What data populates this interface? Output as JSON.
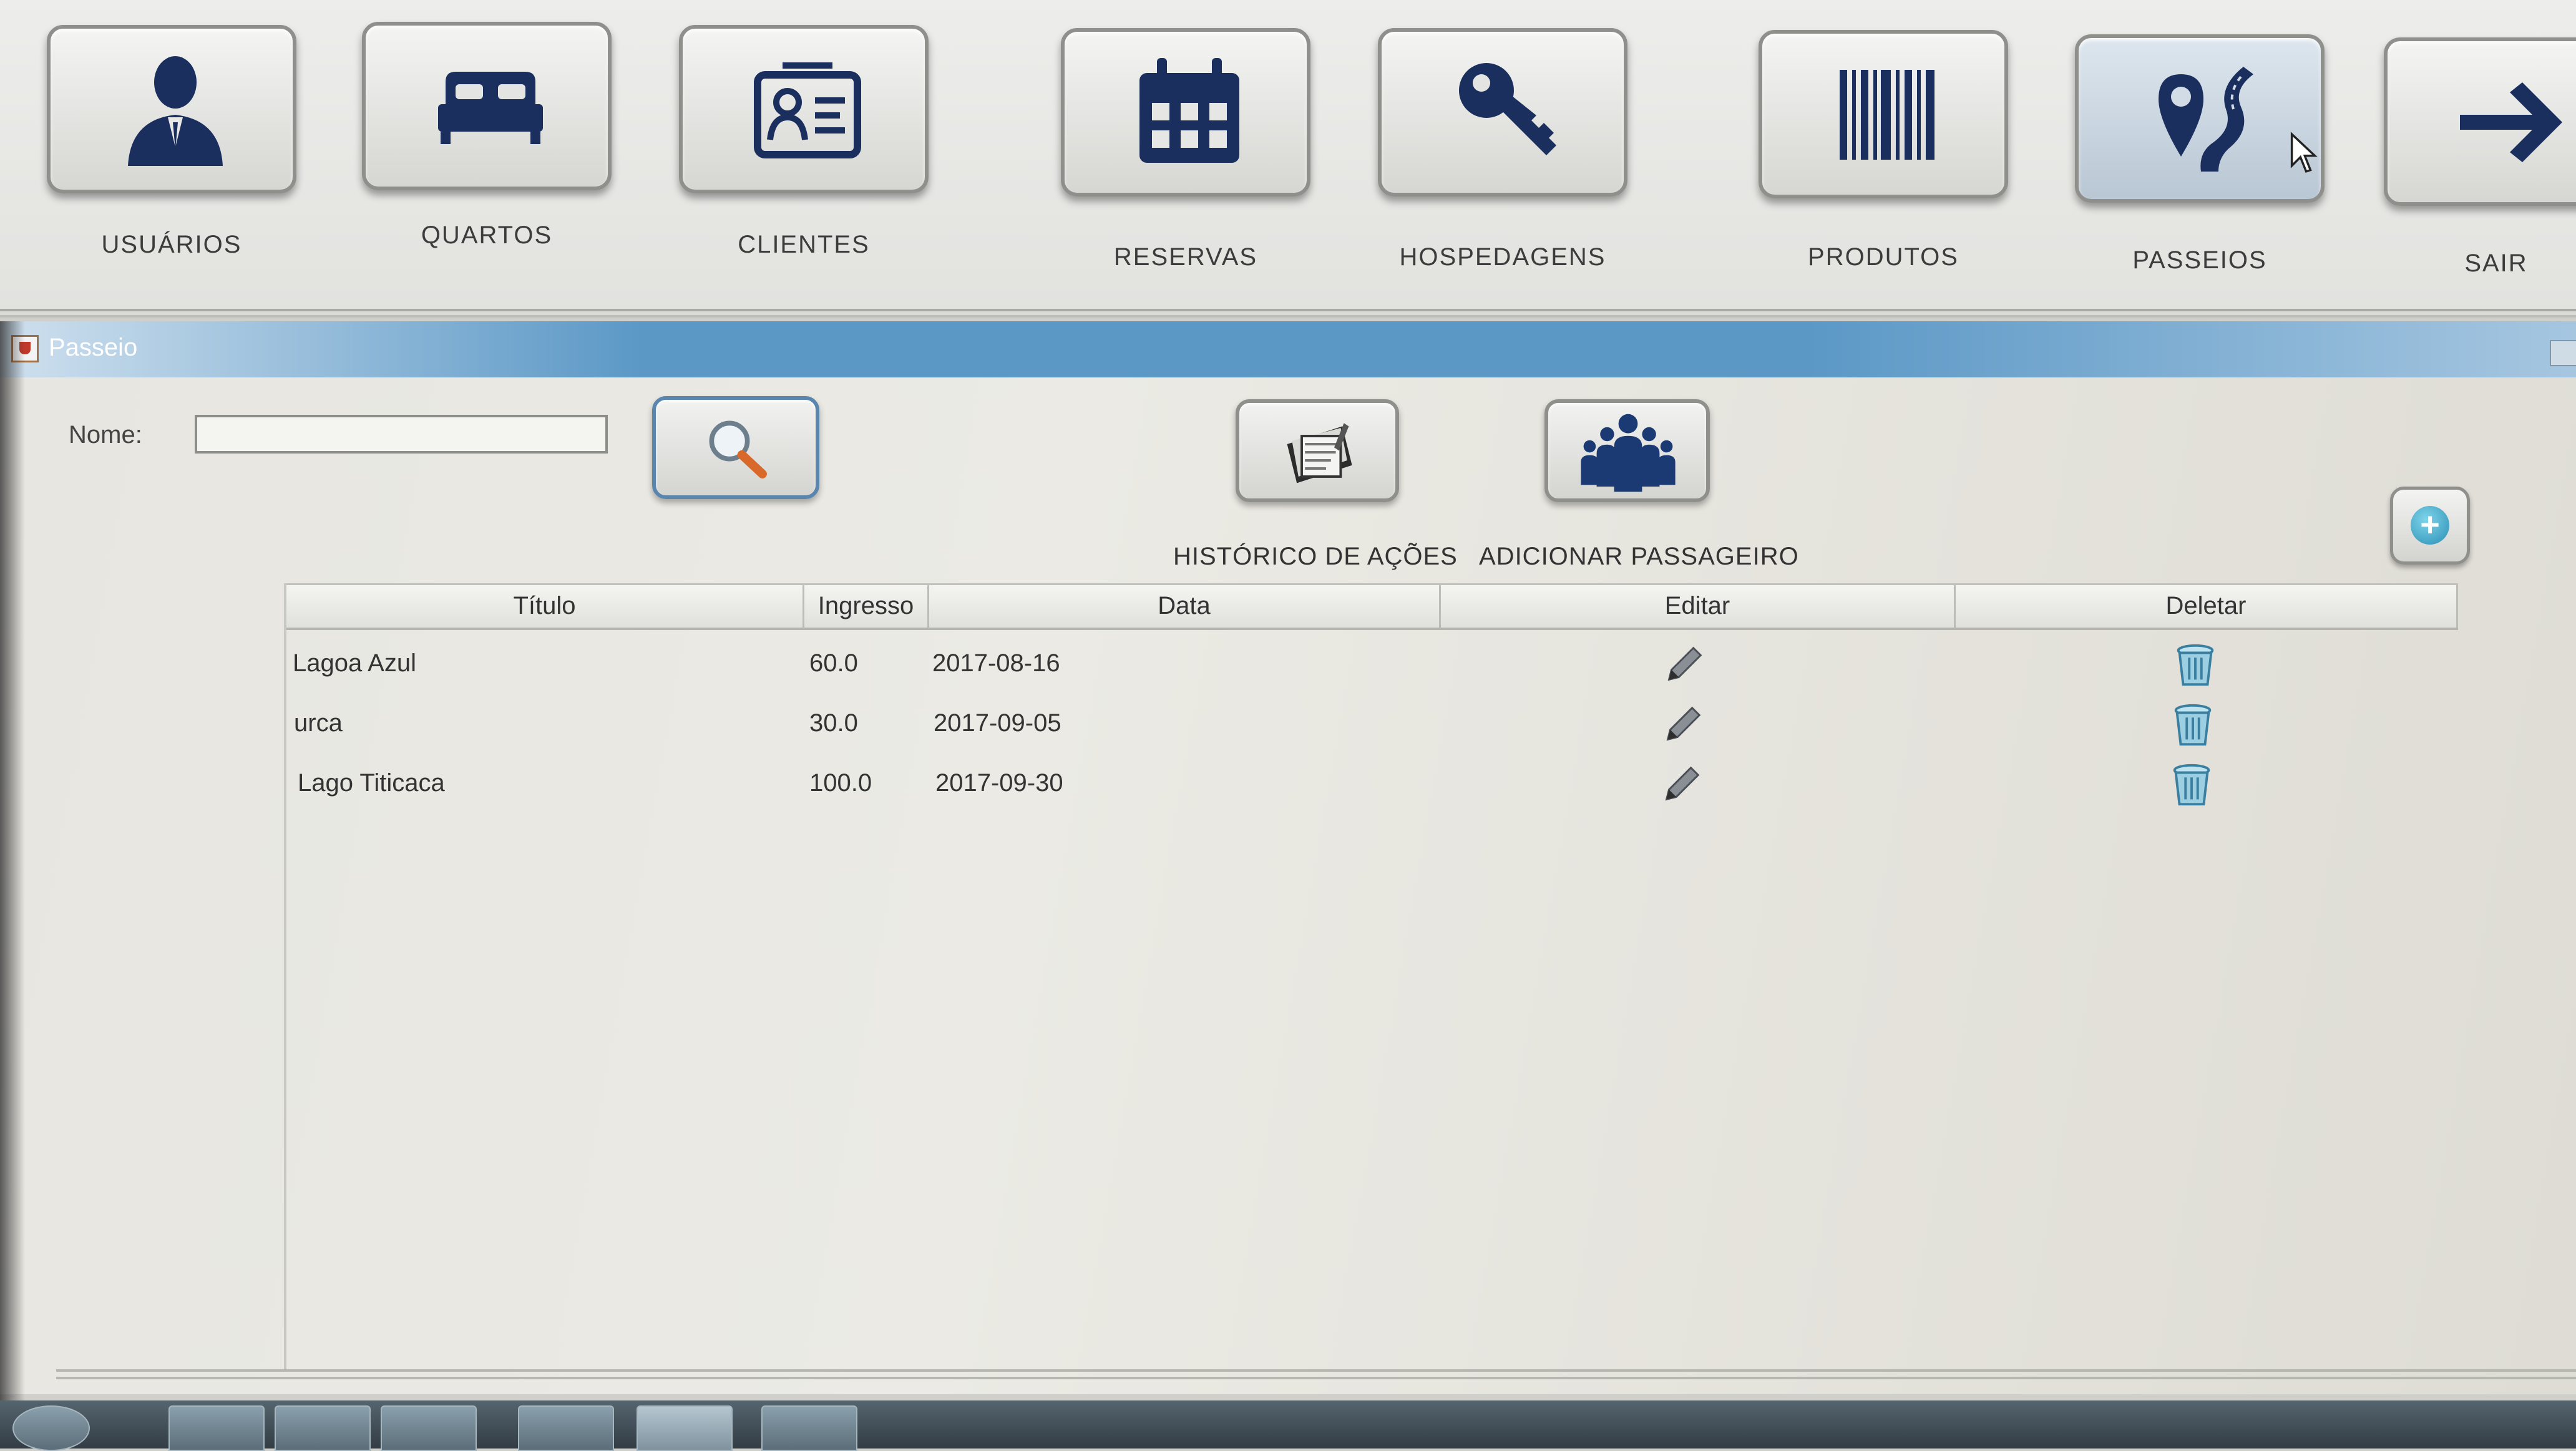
{
  "toolbar": {
    "items": [
      {
        "label": "USUÁRIOS",
        "icon": "user-icon"
      },
      {
        "label": "QUARTOS",
        "icon": "bed-icon"
      },
      {
        "label": "CLIENTES",
        "icon": "contact-card-icon"
      },
      {
        "label": "RESERVAS",
        "icon": "calendar-icon"
      },
      {
        "label": "HOSPEDAGENS",
        "icon": "key-icon"
      },
      {
        "label": "PRODUTOS",
        "icon": "barcode-icon"
      },
      {
        "label": "PASSEIOS",
        "icon": "map-pin-road-icon"
      },
      {
        "label": "SAIR",
        "icon": "arrow-right-icon"
      }
    ],
    "active": "PASSEIOS"
  },
  "window": {
    "title": "Passeio"
  },
  "search": {
    "label": "Nome:",
    "value": "",
    "placeholder": ""
  },
  "actions": {
    "history_label": "HISTÓRICO DE AÇÕES",
    "add_passenger_label": "ADICIONAR PASSAGEIRO"
  },
  "table": {
    "columns": [
      "Título",
      "Ingresso",
      "Data",
      "Editar",
      "Deletar"
    ],
    "rows": [
      {
        "titulo": "Lagoa Azul",
        "ingresso": "60.0",
        "data": "2017-08-16"
      },
      {
        "titulo": "urca",
        "ingresso": "30.0",
        "data": "2017-09-05"
      },
      {
        "titulo": "Lago Titicaca",
        "ingresso": "100.0",
        "data": "2017-09-30"
      }
    ]
  },
  "colors": {
    "icon_navy": "#1b2f5e",
    "title_bar": "#5b98c6",
    "accent_blue": "#5a86ad"
  }
}
